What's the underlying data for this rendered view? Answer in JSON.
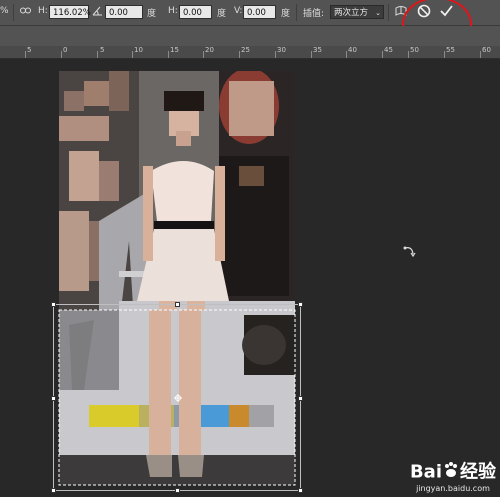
{
  "options_bar": {
    "x_partial": "%",
    "link_icon": "chain-link-icon",
    "h_label": "H:",
    "h_scale": "116.02%",
    "angle_icon": "angle-icon",
    "angle_value": "0.00",
    "angle_unit": "度",
    "skew_h_label": "H:",
    "skew_h_value": "0.00",
    "skew_h_unit": "度",
    "skew_v_label": "V:",
    "skew_v_value": "0.00",
    "skew_v_unit": "度",
    "interp_label": "插值:",
    "interp_value": "两次立方",
    "warp_icon": "warp-icon",
    "cancel_icon": "cancel-icon",
    "commit_icon": "commit-check-icon"
  },
  "ruler": {
    "labels": [
      "5",
      "0",
      "5",
      "10",
      "15",
      "20",
      "25",
      "30",
      "35",
      "40",
      "45",
      "50",
      "55",
      "60"
    ]
  },
  "watermark": {
    "brand": "Bai",
    "brand_suffix": "经验",
    "url": "jingyan.baidu.com"
  },
  "colors": {
    "annotation": "#e0141b",
    "panel": "#535353",
    "canvas": "#282828"
  }
}
